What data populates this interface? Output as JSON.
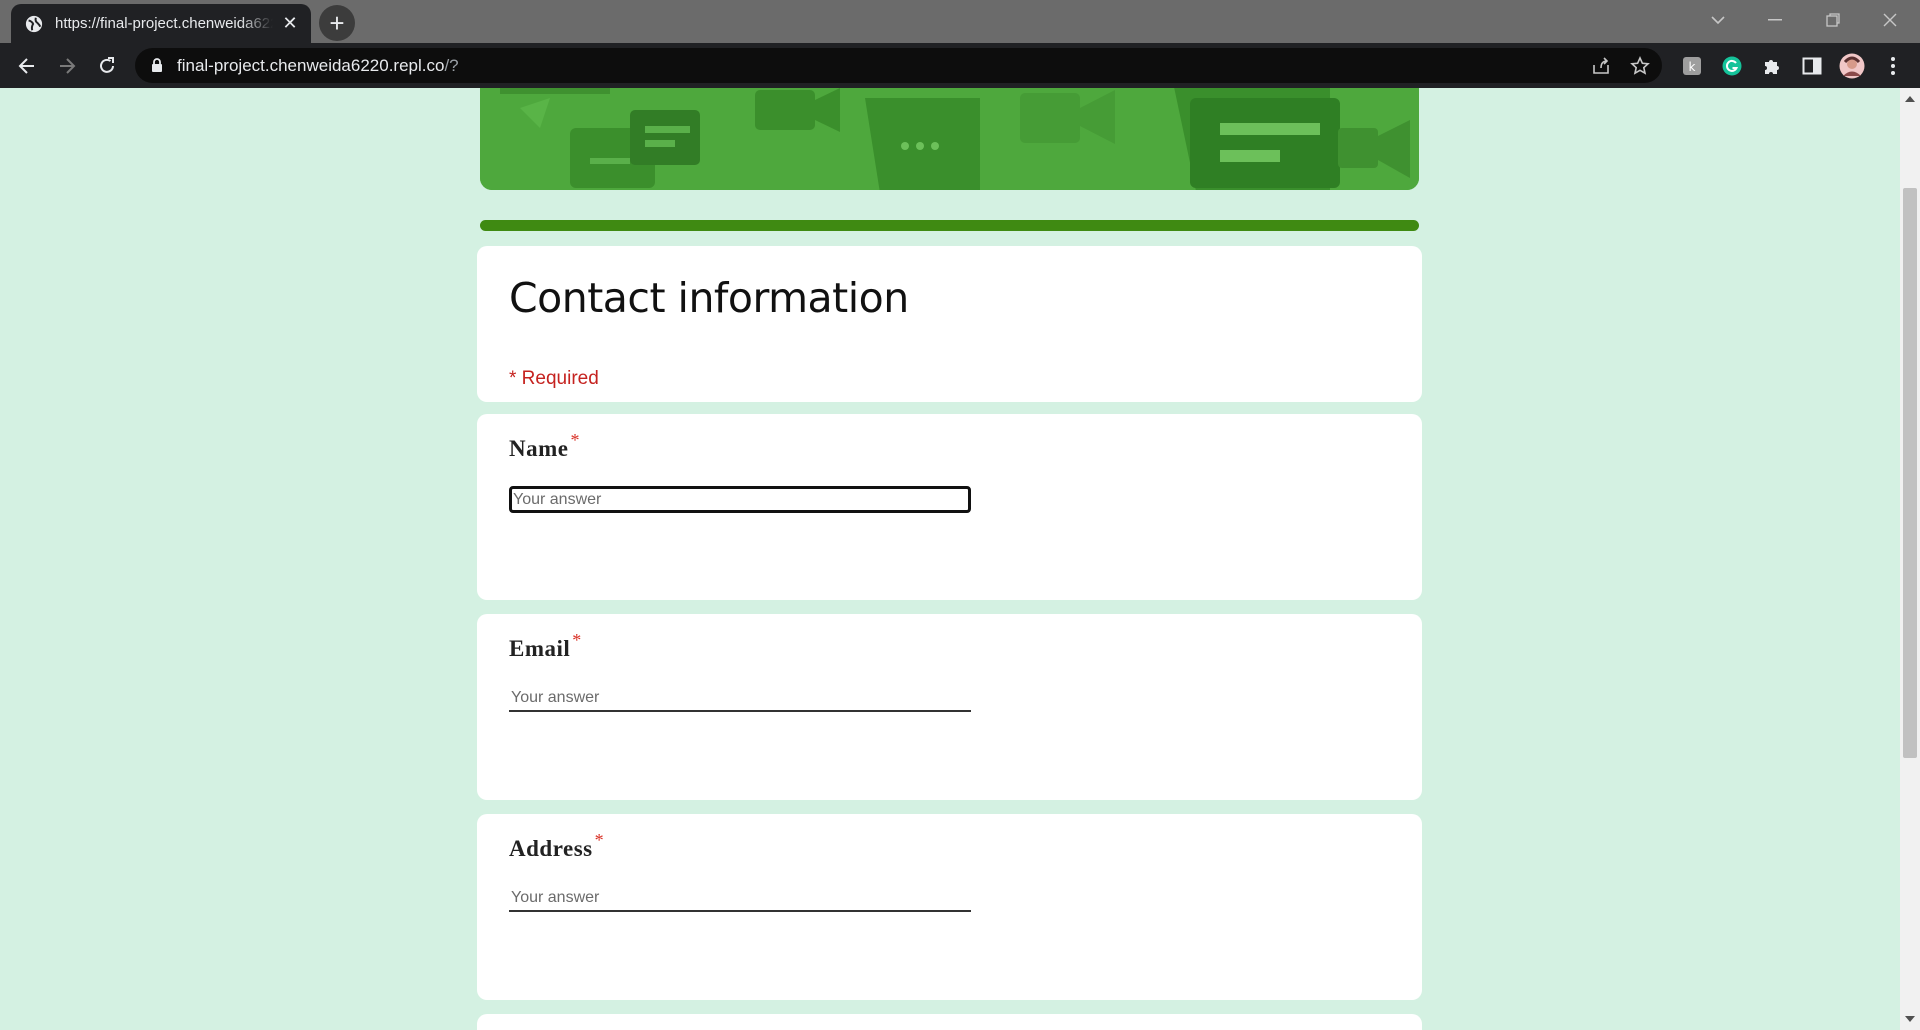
{
  "browser": {
    "tab_title": "https://final-project.chenweida6220.repl.co/?",
    "url_main": "final-project.chenweida6220.repl.co",
    "url_rest": "/?"
  },
  "form": {
    "title": "Contact information",
    "required_note": "* Required",
    "accent_color": "#3f8a12",
    "banner_color": "#4ea83d",
    "questions": [
      {
        "label": "Name",
        "star": "*",
        "placeholder": "Your answer"
      },
      {
        "label": "Email",
        "star": "*",
        "placeholder": "Your answer"
      },
      {
        "label": "Address",
        "star": "*",
        "placeholder": "Your answer"
      }
    ]
  }
}
